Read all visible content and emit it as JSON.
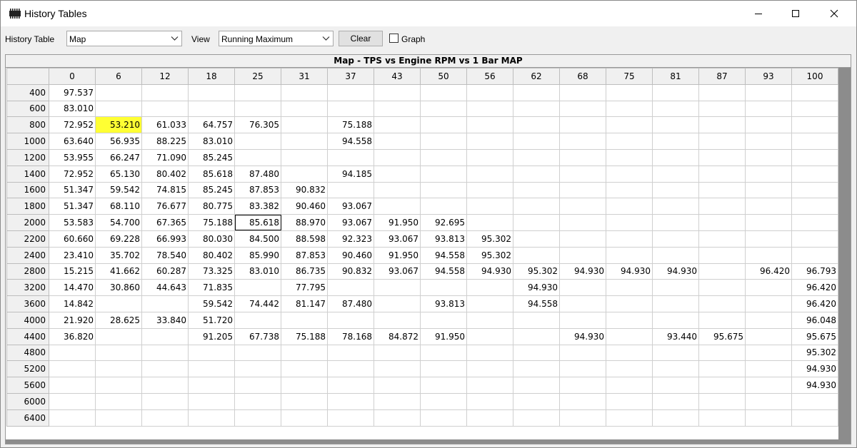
{
  "window": {
    "title": "History Tables",
    "icon": "app-chip-icon"
  },
  "toolbar": {
    "history_table_label": "History Table",
    "history_table_value": "Map",
    "view_label": "View",
    "view_value": "Running Maximum",
    "clear_label": "Clear",
    "graph_label": "Graph",
    "graph_checked": false
  },
  "table": {
    "title": "Map - TPS vs Engine RPM vs 1 Bar MAP",
    "columns": [
      "0",
      "6",
      "12",
      "18",
      "25",
      "31",
      "37",
      "43",
      "50",
      "56",
      "62",
      "68",
      "75",
      "81",
      "87",
      "93",
      "100"
    ],
    "rows": [
      {
        "rpm": "400",
        "cells": [
          "97.537",
          "",
          "",
          "",
          "",
          "",
          "",
          "",
          "",
          "",
          "",
          "",
          "",
          "",
          "",
          "",
          ""
        ]
      },
      {
        "rpm": "600",
        "cells": [
          "83.010",
          "",
          "",
          "",
          "",
          "",
          "",
          "",
          "",
          "",
          "",
          "",
          "",
          "",
          "",
          "",
          ""
        ]
      },
      {
        "rpm": "800",
        "cells": [
          "72.952",
          "53.210",
          "61.033",
          "64.757",
          "76.305",
          "",
          "75.188",
          "",
          "",
          "",
          "",
          "",
          "",
          "",
          "",
          "",
          ""
        ]
      },
      {
        "rpm": "1000",
        "cells": [
          "63.640",
          "56.935",
          "88.225",
          "83.010",
          "",
          "",
          "94.558",
          "",
          "",
          "",
          "",
          "",
          "",
          "",
          "",
          "",
          ""
        ]
      },
      {
        "rpm": "1200",
        "cells": [
          "53.955",
          "66.247",
          "71.090",
          "85.245",
          "",
          "",
          "",
          "",
          "",
          "",
          "",
          "",
          "",
          "",
          "",
          "",
          ""
        ]
      },
      {
        "rpm": "1400",
        "cells": [
          "72.952",
          "65.130",
          "80.402",
          "85.618",
          "87.480",
          "",
          "94.185",
          "",
          "",
          "",
          "",
          "",
          "",
          "",
          "",
          "",
          ""
        ]
      },
      {
        "rpm": "1600",
        "cells": [
          "51.347",
          "59.542",
          "74.815",
          "85.245",
          "87.853",
          "90.832",
          "",
          "",
          "",
          "",
          "",
          "",
          "",
          "",
          "",
          "",
          ""
        ]
      },
      {
        "rpm": "1800",
        "cells": [
          "51.347",
          "68.110",
          "76.677",
          "80.775",
          "83.382",
          "90.460",
          "93.067",
          "",
          "",
          "",
          "",
          "",
          "",
          "",
          "",
          "",
          ""
        ]
      },
      {
        "rpm": "2000",
        "cells": [
          "53.583",
          "54.700",
          "67.365",
          "75.188",
          "85.618",
          "88.970",
          "93.067",
          "91.950",
          "92.695",
          "",
          "",
          "",
          "",
          "",
          "",
          "",
          ""
        ]
      },
      {
        "rpm": "2200",
        "cells": [
          "60.660",
          "69.228",
          "66.993",
          "80.030",
          "84.500",
          "88.598",
          "92.323",
          "93.067",
          "93.813",
          "95.302",
          "",
          "",
          "",
          "",
          "",
          "",
          ""
        ]
      },
      {
        "rpm": "2400",
        "cells": [
          "23.410",
          "35.702",
          "78.540",
          "80.402",
          "85.990",
          "87.853",
          "90.460",
          "91.950",
          "94.558",
          "95.302",
          "",
          "",
          "",
          "",
          "",
          "",
          ""
        ]
      },
      {
        "rpm": "2800",
        "cells": [
          "15.215",
          "41.662",
          "60.287",
          "73.325",
          "83.010",
          "86.735",
          "90.832",
          "93.067",
          "94.558",
          "94.930",
          "95.302",
          "94.930",
          "94.930",
          "94.930",
          "",
          "96.420",
          "96.793"
        ]
      },
      {
        "rpm": "3200",
        "cells": [
          "14.470",
          "30.860",
          "44.643",
          "71.835",
          "",
          "77.795",
          "",
          "",
          "",
          "",
          "94.930",
          "",
          "",
          "",
          "",
          "",
          "96.420"
        ]
      },
      {
        "rpm": "3600",
        "cells": [
          "14.842",
          "",
          "",
          "59.542",
          "74.442",
          "81.147",
          "87.480",
          "",
          "93.813",
          "",
          "94.558",
          "",
          "",
          "",
          "",
          "",
          "96.420"
        ]
      },
      {
        "rpm": "4000",
        "cells": [
          "21.920",
          "28.625",
          "33.840",
          "51.720",
          "",
          "",
          "",
          "",
          "",
          "",
          "",
          "",
          "",
          "",
          "",
          "",
          "96.048"
        ]
      },
      {
        "rpm": "4400",
        "cells": [
          "36.820",
          "",
          "",
          "91.205",
          "67.738",
          "75.188",
          "78.168",
          "84.872",
          "91.950",
          "",
          "",
          "94.930",
          "",
          "93.440",
          "95.675",
          "",
          "95.675"
        ]
      },
      {
        "rpm": "4800",
        "cells": [
          "",
          "",
          "",
          "",
          "",
          "",
          "",
          "",
          "",
          "",
          "",
          "",
          "",
          "",
          "",
          "",
          "95.302"
        ]
      },
      {
        "rpm": "5200",
        "cells": [
          "",
          "",
          "",
          "",
          "",
          "",
          "",
          "",
          "",
          "",
          "",
          "",
          "",
          "",
          "",
          "",
          "94.930"
        ]
      },
      {
        "rpm": "5600",
        "cells": [
          "",
          "",
          "",
          "",
          "",
          "",
          "",
          "",
          "",
          "",
          "",
          "",
          "",
          "",
          "",
          "",
          "94.930"
        ]
      },
      {
        "rpm": "6000",
        "cells": [
          "",
          "",
          "",
          "",
          "",
          "",
          "",
          "",
          "",
          "",
          "",
          "",
          "",
          "",
          "",
          "",
          ""
        ]
      },
      {
        "rpm": "6400",
        "cells": [
          "",
          "",
          "",
          "",
          "",
          "",
          "",
          "",
          "",
          "",
          "",
          "",
          "",
          "",
          "",
          "",
          ""
        ]
      }
    ],
    "highlighted_cell": {
      "row": 2,
      "col": 1,
      "color": "#ffff33"
    },
    "selected_cell": {
      "row": 8,
      "col": 4
    }
  }
}
